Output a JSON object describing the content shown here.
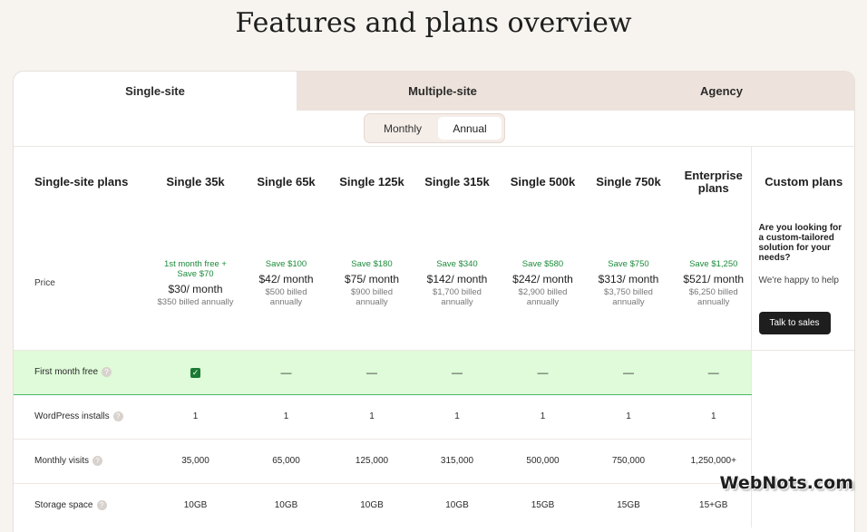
{
  "page_title": "Features and plans overview",
  "tabs": [
    {
      "label": "Single-site",
      "active": true
    },
    {
      "label": "Multiple-site",
      "active": false
    },
    {
      "label": "Agency",
      "active": false
    }
  ],
  "billing_toggle": {
    "monthly": "Monthly",
    "annual": "Annual",
    "selected": "Annual"
  },
  "table": {
    "corner_label": "Single-site plans",
    "plans": [
      {
        "name": "Single 35k",
        "save": "1st month free +\nSave $70",
        "per_month": "$30/ month",
        "billed": "$350 billed annually"
      },
      {
        "name": "Single 65k",
        "save": "Save $100",
        "per_month": "$42/ month",
        "billed": "$500 billed\nannually"
      },
      {
        "name": "Single 125k",
        "save": "Save $180",
        "per_month": "$75/ month",
        "billed": "$900 billed\nannually"
      },
      {
        "name": "Single 315k",
        "save": "Save $340",
        "per_month": "$142/ month",
        "billed": "$1,700 billed\nannually"
      },
      {
        "name": "Single 500k",
        "save": "Save $580",
        "per_month": "$242/ month",
        "billed": "$2,900 billed\nannually"
      },
      {
        "name": "Single 750k",
        "save": "Save $750",
        "per_month": "$313/ month",
        "billed": "$3,750 billed\nannually"
      },
      {
        "name": "Enterprise\nplans",
        "save": "Save $1,250",
        "per_month": "$521/ month",
        "billed": "$6,250 billed\nannually"
      }
    ],
    "price_label": "Price",
    "custom": {
      "title": "Custom plans",
      "question": "Are you looking for a custom-tailored solution for your needs?",
      "help": "We're happy to help",
      "button": "Talk to sales"
    },
    "features": [
      {
        "label": "First month free",
        "values": [
          "check",
          "—",
          "—",
          "—",
          "—",
          "—",
          "—"
        ],
        "highlight": true
      },
      {
        "label": "WordPress installs",
        "values": [
          "1",
          "1",
          "1",
          "1",
          "1",
          "1",
          "1"
        ]
      },
      {
        "label": "Monthly visits",
        "values": [
          "35,000",
          "65,000",
          "125,000",
          "315,000",
          "500,000",
          "750,000",
          "1,250,000+"
        ]
      },
      {
        "label": "Storage space",
        "values": [
          "10GB",
          "10GB",
          "10GB",
          "10GB",
          "15GB",
          "15GB",
          "15+GB"
        ]
      }
    ]
  },
  "watermark": "WebNots.com"
}
